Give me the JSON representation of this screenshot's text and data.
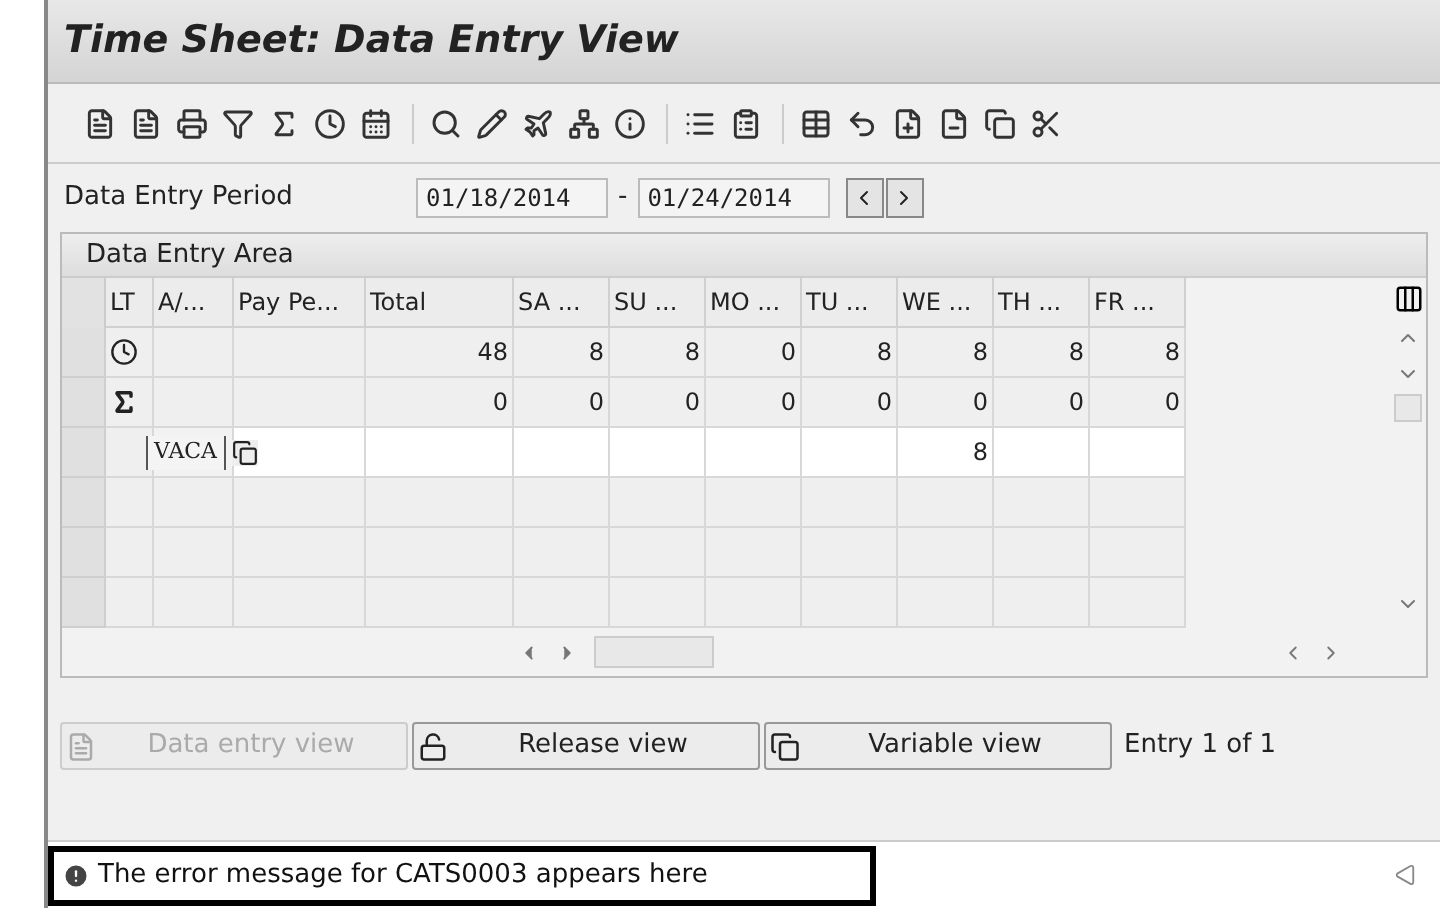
{
  "window": {
    "title": "Time Sheet: Data Entry View"
  },
  "period": {
    "label": "Data Entry Period",
    "from": "01/18/2014",
    "separator": "-",
    "to": "01/24/2014"
  },
  "area": {
    "title": "Data Entry Area",
    "columns": [
      "LT",
      "A/...",
      "Pay Pe...",
      "Total",
      "SA  ...",
      "SU  ...",
      "MO ...",
      "TU ...",
      "WE ...",
      "TH ...",
      "FR  ..."
    ],
    "rows": [
      {
        "kind": "clock",
        "editable": false,
        "cells": [
          null,
          null,
          null,
          "48",
          "8",
          "8",
          "0",
          "8",
          "8",
          "8",
          "8"
        ]
      },
      {
        "kind": "sum",
        "editable": false,
        "cells": [
          null,
          null,
          null,
          "0",
          "0",
          "0",
          "0",
          "0",
          "0",
          "0",
          "0"
        ]
      },
      {
        "kind": "entry",
        "editable": true,
        "cells": [
          null,
          "VACA",
          null,
          null,
          null,
          null,
          null,
          null,
          "8",
          null,
          null
        ]
      },
      {
        "kind": "blank",
        "editable": false,
        "cells": [
          null,
          null,
          null,
          null,
          null,
          null,
          null,
          null,
          null,
          null,
          null
        ]
      },
      {
        "kind": "blank",
        "editable": false,
        "cells": [
          null,
          null,
          null,
          null,
          null,
          null,
          null,
          null,
          null,
          null,
          null
        ]
      },
      {
        "kind": "blank",
        "editable": false,
        "cells": [
          null,
          null,
          null,
          null,
          null,
          null,
          null,
          null,
          null,
          null,
          null
        ]
      }
    ]
  },
  "buttons": [
    {
      "label": "Data entry view",
      "kind": "doc",
      "disabled": true
    },
    {
      "label": "Release view",
      "kind": "lock",
      "disabled": false
    },
    {
      "label": "Variable view",
      "kind": "copy",
      "disabled": false
    }
  ],
  "entry_count": "Entry 1 of 1",
  "status_bar": {
    "kind": "error",
    "message": "The error message for CATS0003 appears here"
  }
}
